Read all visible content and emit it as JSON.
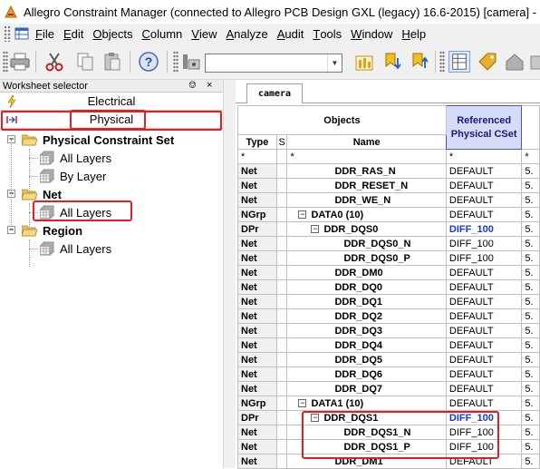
{
  "window": {
    "title": "Allegro Constraint Manager (connected to Allegro PCB Design GXL (legacy) 16.6-2015) [camera] -"
  },
  "menu": [
    {
      "accel": "F",
      "rest": "ile"
    },
    {
      "accel": "E",
      "rest": "dit"
    },
    {
      "accel": "O",
      "rest": "bjects"
    },
    {
      "accel": "C",
      "rest": "olumn"
    },
    {
      "accel": "V",
      "rest": "iew"
    },
    {
      "accel": "A",
      "rest": "nalyze"
    },
    {
      "accel": "A",
      "rest": "udit"
    },
    {
      "accel": "T",
      "rest": "ools"
    },
    {
      "accel": "W",
      "rest": "indow"
    },
    {
      "accel": "H",
      "rest": "elp"
    }
  ],
  "toolbar": {
    "combo_value": "",
    "buttons": [
      "print-icon",
      "cut-icon",
      "copy-icon",
      "paste-icon",
      "help-icon",
      "filter-icon",
      "analyze-icon",
      "bookmark-down-icon",
      "bookmark-up-icon",
      "worksheet-icon",
      "tag-icon",
      "home-icon",
      "extra-icon"
    ]
  },
  "worksheet_selector": {
    "title": "Worksheet selector",
    "pin": "ᵘ",
    "close": "×",
    "tabs": [
      {
        "label": "Electrical",
        "icon": "lightning-icon"
      },
      {
        "label": "Physical",
        "icon": "physical-icon"
      }
    ],
    "tree": [
      {
        "label": "Physical Constraint Set",
        "level": 0,
        "expander": "−",
        "type": "folder"
      },
      {
        "label": "All Layers",
        "level": 1,
        "type": "layers"
      },
      {
        "label": "By Layer",
        "level": 1,
        "type": "layers"
      },
      {
        "label": "Net",
        "level": 0,
        "expander": "−",
        "type": "folder"
      },
      {
        "label": "All Layers",
        "level": 1,
        "type": "layers"
      },
      {
        "label": "Region",
        "level": 0,
        "expander": "−",
        "type": "folder"
      },
      {
        "label": "All Layers",
        "level": 1,
        "type": "layers"
      }
    ]
  },
  "worksheet_tab": "camera",
  "grid": {
    "objects_header": "Objects",
    "type_header": "Type",
    "s_header": "S",
    "name_header": "Name",
    "ref_header_line1": "Referenced",
    "ref_header_line2": "Physical CSet",
    "next_col_header": "",
    "filter_row": [
      "*",
      "",
      "*",
      "*",
      "*"
    ],
    "rows": [
      {
        "type": "Net",
        "name": "DDR_RAS_N",
        "indent": 2,
        "cset": "DEFAULT",
        "next": "5."
      },
      {
        "type": "Net",
        "name": "DDR_RESET_N",
        "indent": 2,
        "cset": "DEFAULT",
        "next": "5."
      },
      {
        "type": "Net",
        "name": "DDR_WE_N",
        "indent": 2,
        "cset": "DEFAULT",
        "next": "5."
      },
      {
        "type": "NGrp",
        "name": "DATA0 (10)",
        "indent": 0,
        "expander": "−",
        "cset": "DEFAULT",
        "next": "5."
      },
      {
        "type": "DPr",
        "name": "DDR_DQS0",
        "indent": 1,
        "expander": "−",
        "cset": "DIFF_100",
        "cset_blue": true,
        "next": "5."
      },
      {
        "type": "Net",
        "name": "DDR_DQS0_N",
        "indent": 3,
        "cset": "DIFF_100",
        "next": "5."
      },
      {
        "type": "Net",
        "name": "DDR_DQS0_P",
        "indent": 3,
        "cset": "DIFF_100",
        "next": "5."
      },
      {
        "type": "Net",
        "name": "DDR_DM0",
        "indent": 2,
        "cset": "DEFAULT",
        "next": "5."
      },
      {
        "type": "Net",
        "name": "DDR_DQ0",
        "indent": 2,
        "cset": "DEFAULT",
        "next": "5."
      },
      {
        "type": "Net",
        "name": "DDR_DQ1",
        "indent": 2,
        "cset": "DEFAULT",
        "next": "5."
      },
      {
        "type": "Net",
        "name": "DDR_DQ2",
        "indent": 2,
        "cset": "DEFAULT",
        "next": "5."
      },
      {
        "type": "Net",
        "name": "DDR_DQ3",
        "indent": 2,
        "cset": "DEFAULT",
        "next": "5."
      },
      {
        "type": "Net",
        "name": "DDR_DQ4",
        "indent": 2,
        "cset": "DEFAULT",
        "next": "5."
      },
      {
        "type": "Net",
        "name": "DDR_DQ5",
        "indent": 2,
        "cset": "DEFAULT",
        "next": "5."
      },
      {
        "type": "Net",
        "name": "DDR_DQ6",
        "indent": 2,
        "cset": "DEFAULT",
        "next": "5."
      },
      {
        "type": "Net",
        "name": "DDR_DQ7",
        "indent": 2,
        "cset": "DEFAULT",
        "next": "5."
      },
      {
        "type": "NGrp",
        "name": "DATA1 (10)",
        "indent": 0,
        "expander": "−",
        "cset": "DEFAULT",
        "next": "5."
      },
      {
        "type": "DPr",
        "name": "DDR_DQS1",
        "indent": 1,
        "expander": "−",
        "cset": "DIFF_100",
        "cset_blue": true,
        "next": "5."
      },
      {
        "type": "Net",
        "name": "DDR_DQS1_N",
        "indent": 3,
        "cset": "DIFF_100",
        "next": "5."
      },
      {
        "type": "Net",
        "name": "DDR_DQS1_P",
        "indent": 3,
        "cset": "DIFF_100",
        "next": "5."
      },
      {
        "type": "Net",
        "name": "DDR_DM1",
        "indent": 2,
        "cset": "DEFAULT",
        "next": "5."
      }
    ]
  },
  "colors": {
    "highlight": "#e02020",
    "ref_header_bg": "#d4dcf7",
    "cset_blue": "#1a3ad8"
  }
}
